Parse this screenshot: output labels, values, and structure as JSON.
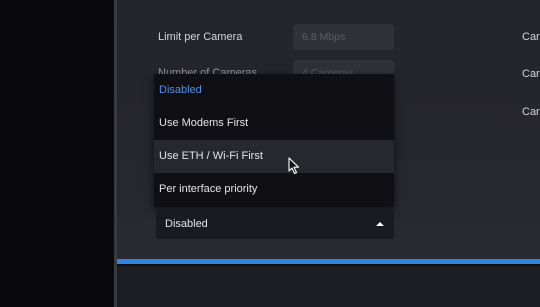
{
  "settings": {
    "rows": [
      {
        "label": "Limit per Camera",
        "value": "6.8 Mbps",
        "right": "Car"
      },
      {
        "label": "Number of Cameras",
        "value": "4 Cameras",
        "right": "Car"
      },
      {
        "label": "",
        "value": "",
        "right": "Car"
      }
    ]
  },
  "dropdown": {
    "options": [
      {
        "label": "Disabled",
        "state": "selected"
      },
      {
        "label": "Use Modems First",
        "state": "normal"
      },
      {
        "label": "Use ETH / Wi-Fi First",
        "state": "hover"
      },
      {
        "label": "Per interface priority",
        "state": "normal"
      }
    ],
    "selected_value": "Disabled",
    "caret_icon": "caret-up-icon"
  },
  "colors": {
    "accent": "#2f86e0",
    "selected_option": "#4e8fe3",
    "panel_bg": "#25262c"
  }
}
